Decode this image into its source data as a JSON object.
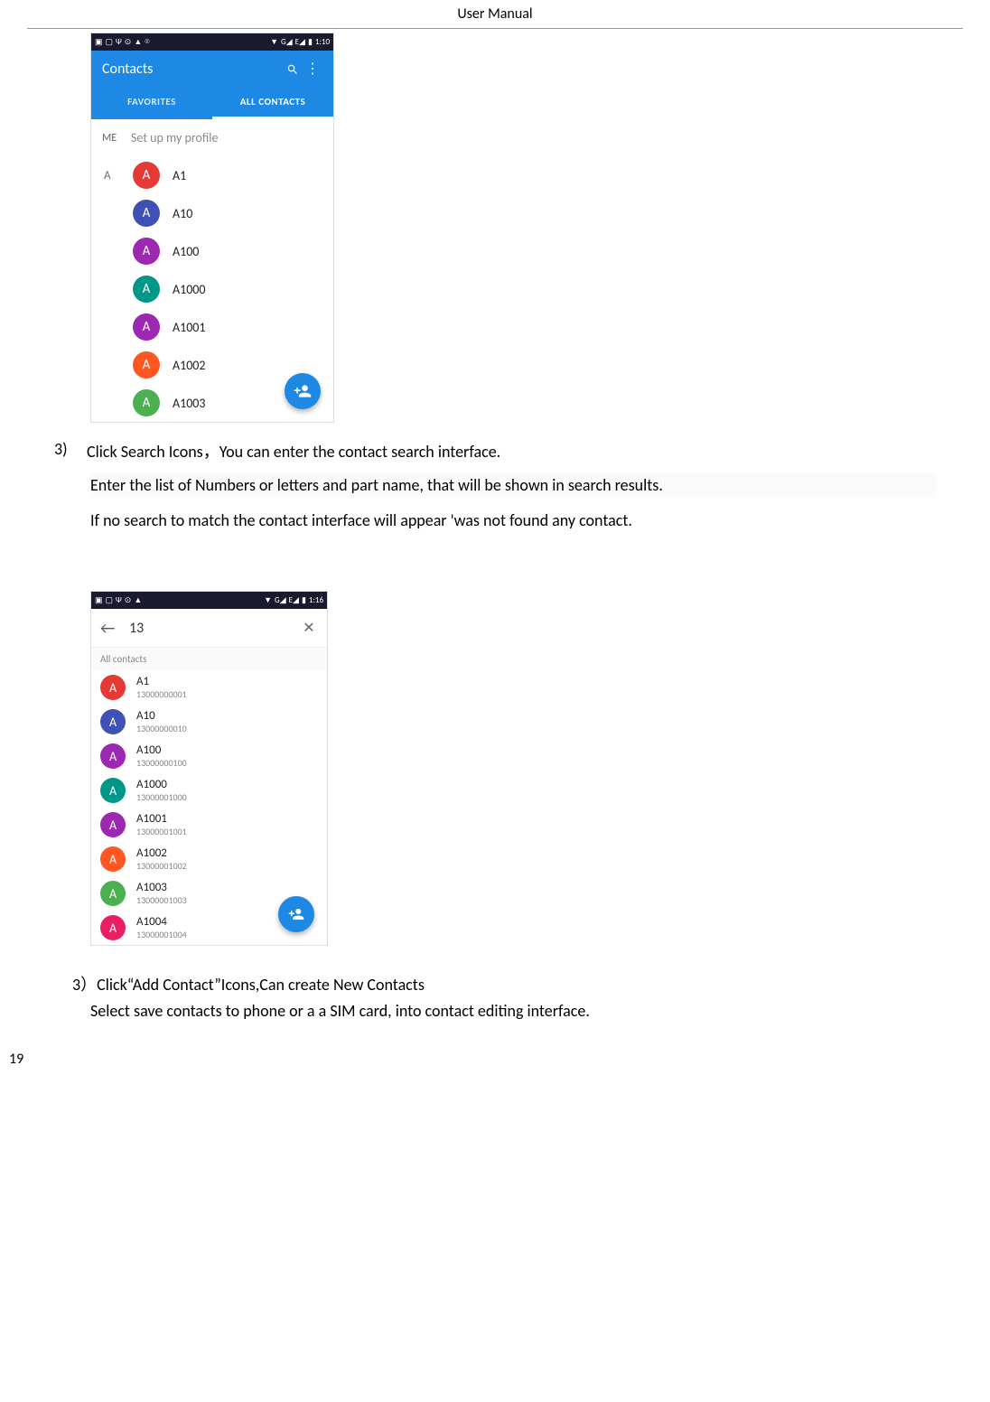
{
  "header": "User    Manual",
  "page_number": "19",
  "screenshot1": {
    "time": "1:10",
    "app_title": "Contacts",
    "tabs": {
      "favorites": "FAVORITES",
      "all": "ALL CONTACTS"
    },
    "me_label": "ME",
    "me_text": "Set up my profile",
    "section_letter": "A",
    "contacts": [
      {
        "letter": "A",
        "name": "A1",
        "color": "#e53935"
      },
      {
        "letter": "A",
        "name": "A10",
        "color": "#3f51b5"
      },
      {
        "letter": "A",
        "name": "A100",
        "color": "#9c27b0"
      },
      {
        "letter": "A",
        "name": "A1000",
        "color": "#009688"
      },
      {
        "letter": "A",
        "name": "A1001",
        "color": "#9c27b0"
      },
      {
        "letter": "A",
        "name": "A1002",
        "color": "#ff5722"
      },
      {
        "letter": "A",
        "name": "A1003",
        "color": "#4caf50"
      }
    ]
  },
  "step3": {
    "num": "3)",
    "line1a": "Click Search Icons，",
    "line1b": "You c",
    "line1c": "an enter the contact search interface.",
    "line2": "Enter the list of Numbers or letters and part name, that will be shown in search results.",
    "line3": "If no search to match the contact interface will appear 'was not found any contact."
  },
  "screenshot2": {
    "time": "1:16",
    "search_value": "13",
    "all_label": "All contacts",
    "contacts": [
      {
        "letter": "A",
        "name": "A1",
        "number": "13000000001",
        "color": "#e53935"
      },
      {
        "letter": "A",
        "name": "A10",
        "number": "13000000010",
        "color": "#3f51b5"
      },
      {
        "letter": "A",
        "name": "A100",
        "number": "13000000100",
        "color": "#9c27b0"
      },
      {
        "letter": "A",
        "name": "A1000",
        "number": "13000001000",
        "color": "#009688"
      },
      {
        "letter": "A",
        "name": "A1001",
        "number": "13000001001",
        "color": "#9c27b0"
      },
      {
        "letter": "A",
        "name": "A1002",
        "number": "13000001002",
        "color": "#ff5722"
      },
      {
        "letter": "A",
        "name": "A1003",
        "number": "13000001003",
        "color": "#4caf50"
      },
      {
        "letter": "A",
        "name": "A1004",
        "number": "13000001004",
        "color": "#e91e63"
      }
    ]
  },
  "step3b": {
    "prefix": "3）",
    "line1": "Click“Add    Contact”Icons,Can create New Contacts",
    "line2": "Select save contacts to phone or a a SIM card, into contact editing interface."
  }
}
